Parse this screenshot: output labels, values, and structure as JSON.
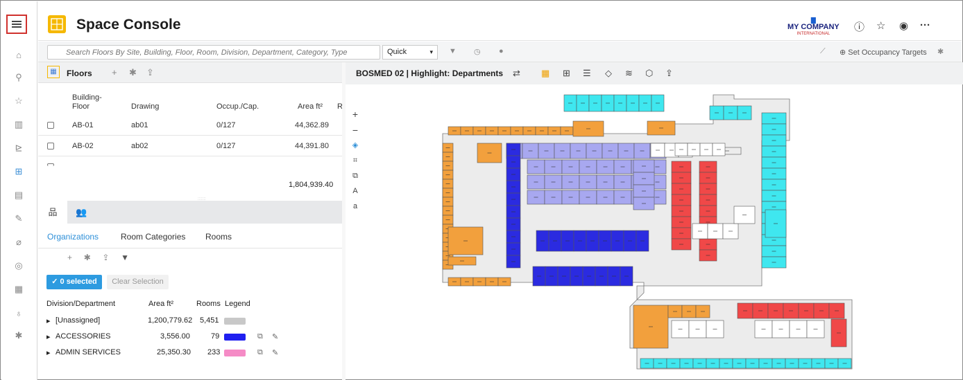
{
  "app": {
    "title": "Space Console",
    "company_name": "MY COMPANY",
    "company_sub": "INTERNATIONAL",
    "more": "···"
  },
  "search": {
    "placeholder": "Search Floors By Site, Building, Floor, Room, Division, Department, Category, Type",
    "mode": "Quick",
    "occupancy_label": "Set Occupancy Targets"
  },
  "floors": {
    "label": "Floors",
    "columns": [
      "Building-\nFloor",
      "Drawing",
      "Occup./Cap.",
      "Area ft²",
      "R"
    ],
    "rows": [
      {
        "floor": "AB-01",
        "drawing": "ab01",
        "occupancy": "0/127",
        "area": "44,362.89"
      },
      {
        "floor": "AB-02",
        "drawing": "ab02",
        "occupancy": "0/127",
        "area": "44,391.80"
      }
    ],
    "total_area": "1,804,939.40"
  },
  "plan": {
    "title": "BOSMED 02 | Highlight: Departments"
  },
  "org": {
    "subtabs": [
      "Organizations",
      "Room Categories",
      "Rooms"
    ],
    "selected_label": "0 selected",
    "clear_label": "Clear Selection",
    "headers": {
      "division": "Division/Department",
      "area": "Area ft²",
      "rooms": "Rooms",
      "legend": "Legend"
    },
    "rows": [
      {
        "name": "[Unassigned]",
        "area": "1,200,779.62",
        "rooms": "5,451",
        "color": "#c8c8c8"
      },
      {
        "name": "ACCESSORIES",
        "area": "3,556.00",
        "rooms": "79",
        "color": "#1f1ff0"
      },
      {
        "name": "ADMIN SERVICES",
        "area": "25,350.30",
        "rooms": "233",
        "color": "#f58bc6"
      }
    ]
  },
  "colors": {
    "accent": "#2d8fd8",
    "orange": "#f2a03d",
    "cyan": "#3fe7ef",
    "lavender": "#a8a8f0",
    "blue": "#2b2be0",
    "red": "#f04848"
  }
}
